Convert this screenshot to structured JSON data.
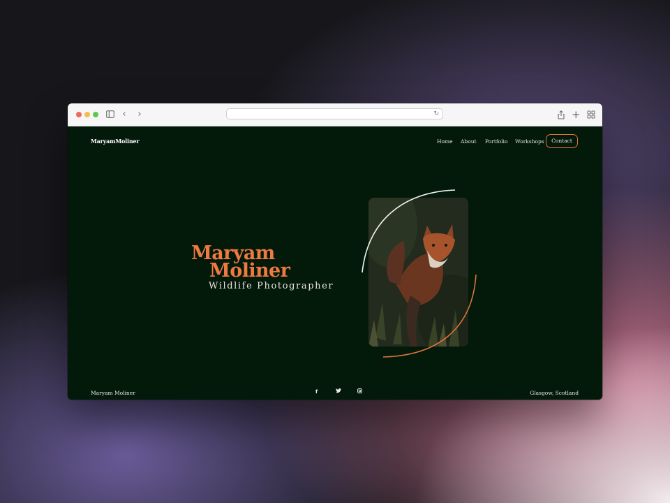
{
  "browser": {
    "address": "",
    "icons": {
      "sidebar": "sidebar-icon",
      "back": "chevron-left-icon",
      "forward": "chevron-right-icon",
      "reload": "reload-icon",
      "share": "share-icon",
      "new_tab": "plus-icon",
      "tabs": "tab-overview-icon"
    }
  },
  "site": {
    "logo": "MaryamMoliner",
    "nav": {
      "home": "Home",
      "about": "About",
      "portfolio": "Portfolio",
      "workshops": "Workshops",
      "contact": "Contact"
    },
    "hero": {
      "first_name": "Maryam",
      "last_name": "Moliner",
      "subtitle": "Wildlife Photographer"
    },
    "photo_alt": "Red fox",
    "footer": {
      "name": "Maryam Moliner",
      "location": "Glasgow, Scotland",
      "social": {
        "facebook": "f",
        "twitter": "twitter-icon",
        "instagram": "instagram-icon"
      }
    }
  },
  "colors": {
    "background": "#031a0b",
    "accent": "#ee7a42",
    "text": "#eae6df"
  }
}
